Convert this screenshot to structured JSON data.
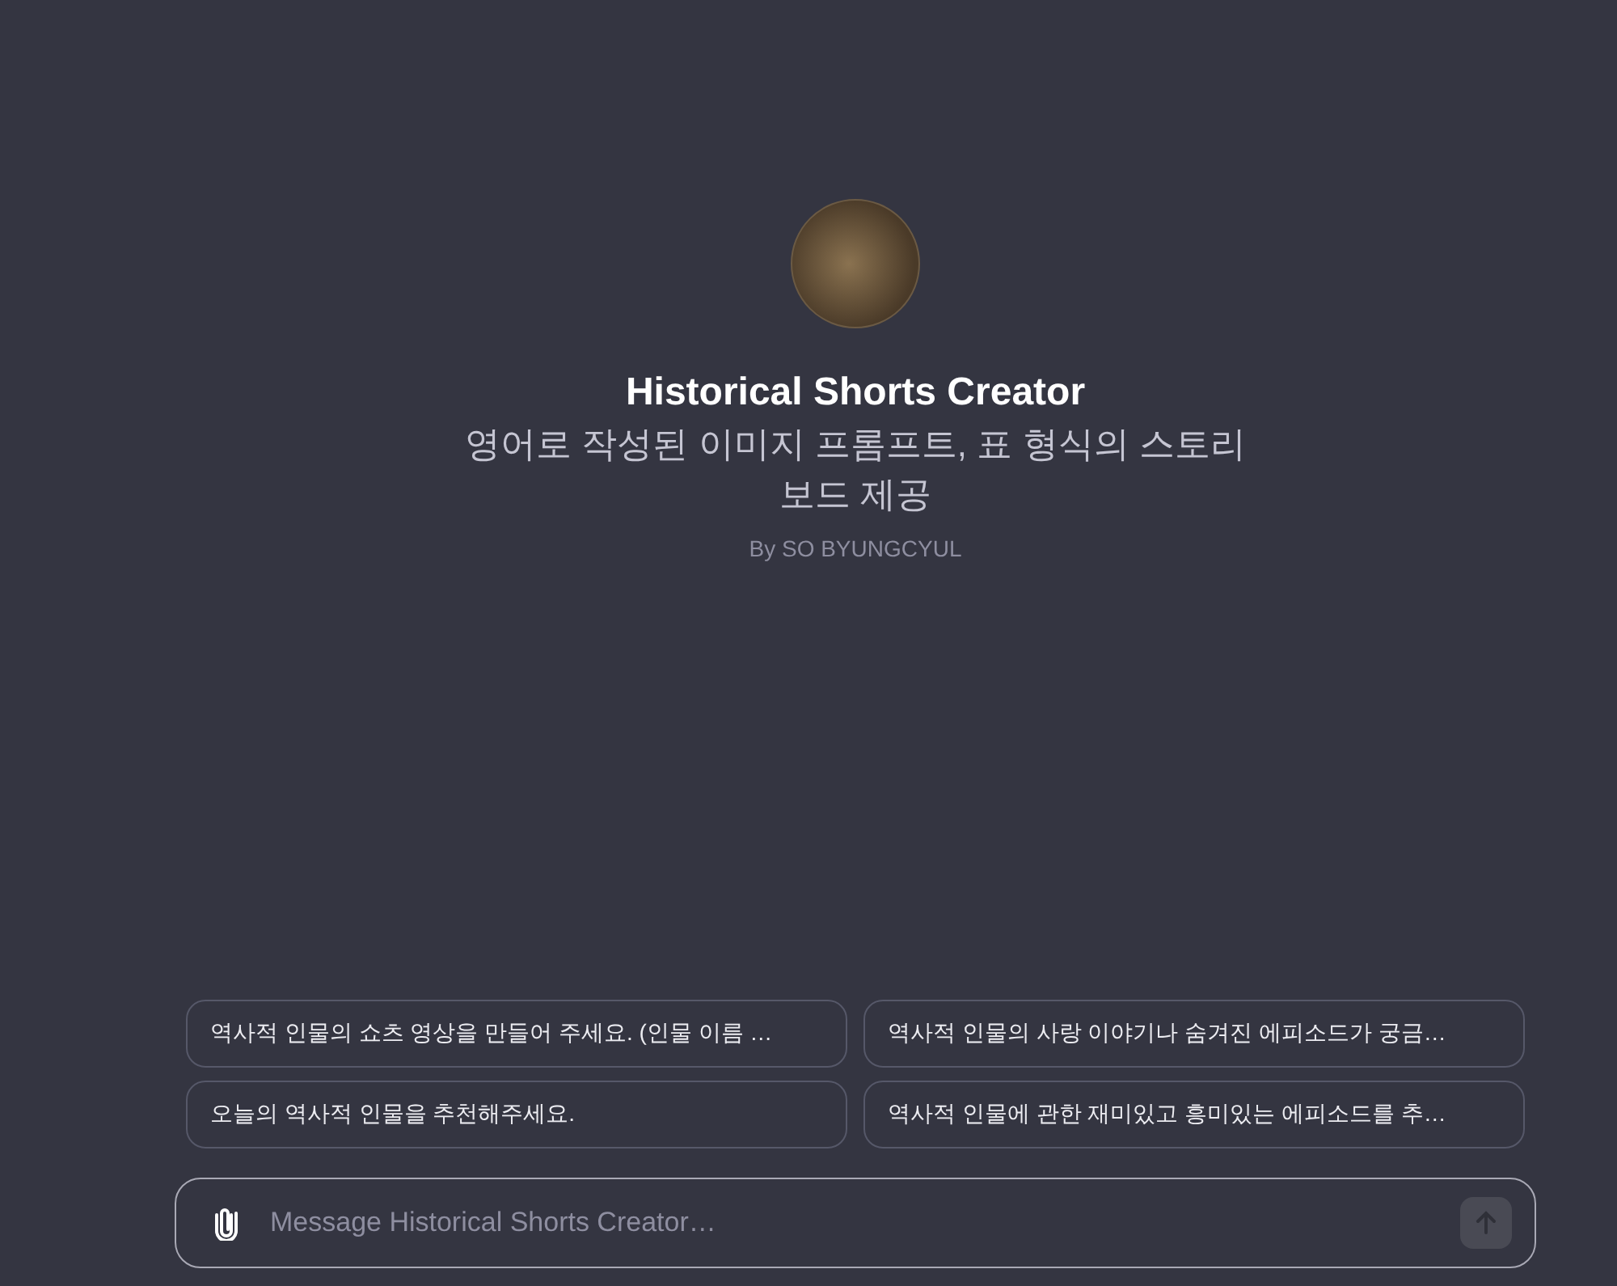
{
  "gpt": {
    "name": "Historical Shorts Creator",
    "description": "영어로 작성된 이미지 프롬프트, 표 형식의 스토리 보드 제공",
    "author": "By SO BYUNGCYUL"
  },
  "suggestions": [
    "역사적 인물의 쇼츠 영상을 만들어 주세요. (인물 이름 …",
    "역사적 인물의 사랑 이야기나 숨겨진 에피소드가 궁금…",
    "오늘의 역사적 인물을 추천해주세요.",
    "역사적 인물에 관한 재미있고 흥미있는 에피소드를 추…"
  ],
  "composer": {
    "placeholder": "Message Historical Shorts Creator…"
  }
}
